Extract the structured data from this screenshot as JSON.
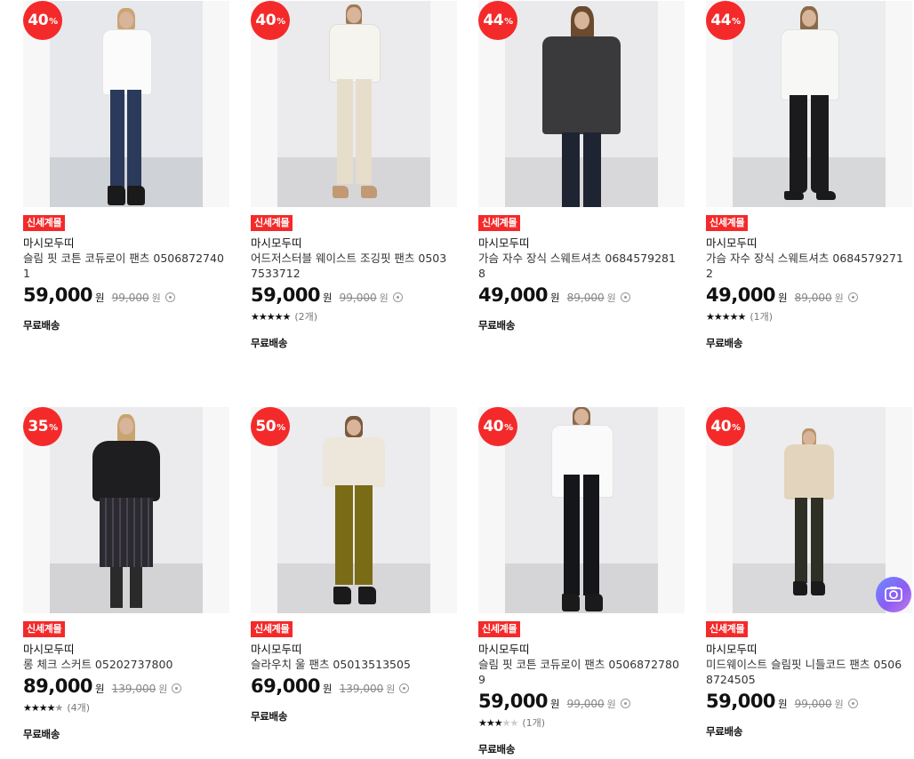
{
  "products": [
    {
      "discount": "40",
      "badge": "신세계몰",
      "brand": "마시모두띠",
      "name": "슬림 핏 코튼 코듀로이 팬츠 05068727401",
      "price": "59,000",
      "original_price": "99,000",
      "currency": "원",
      "stars": null,
      "review_count": null,
      "shipping": "무료배송",
      "look": "white-shirt-navy-jeans"
    },
    {
      "discount": "40",
      "badge": "신세계몰",
      "brand": "마시모두띠",
      "name": "어드저스터블 웨이스트 조깅핏 팬츠 05037533712",
      "price": "59,000",
      "original_price": "99,000",
      "currency": "원",
      "stars": 5,
      "review_count": "(2개)",
      "shipping": "무료배송",
      "look": "cream-sweater-beige-pants"
    },
    {
      "discount": "44",
      "badge": "신세계몰",
      "brand": "마시모두띠",
      "name": "가슴 자수 장식 스웨트셔츠 06845792818",
      "price": "49,000",
      "original_price": "89,000",
      "currency": "원",
      "stars": null,
      "review_count": null,
      "shipping": "무료배송",
      "look": "charcoal-sweatshirt"
    },
    {
      "discount": "44",
      "badge": "신세계몰",
      "brand": "마시모두띠",
      "name": "가슴 자수 장식 스웨트셔츠 06845792712",
      "price": "49,000",
      "original_price": "89,000",
      "currency": "원",
      "stars": 5,
      "review_count": "(1개)",
      "shipping": "무료배송",
      "look": "white-sweatshirt-black-flare"
    },
    {
      "discount": "35",
      "badge": "신세계몰",
      "brand": "마시모두띠",
      "name": "롱 체크 스커트 05202737800",
      "price": "89,000",
      "original_price": "139,000",
      "currency": "원",
      "stars": 4.5,
      "review_count": "(4개)",
      "shipping": "무료배송",
      "look": "black-sweater-check-skirt"
    },
    {
      "discount": "50",
      "badge": "신세계몰",
      "brand": "마시모두띠",
      "name": "슬라우치 울 팬츠 05013513505",
      "price": "69,000",
      "original_price": "139,000",
      "currency": "원",
      "stars": null,
      "review_count": null,
      "shipping": "무료배송",
      "look": "cream-top-olive-pants"
    },
    {
      "discount": "40",
      "badge": "신세계몰",
      "brand": "마시모두띠",
      "name": "슬림 핏 코튼 코듀로이 팬츠 05068727809",
      "price": "59,000",
      "original_price": "99,000",
      "currency": "원",
      "stars": 3,
      "review_count": "(1개)",
      "shipping": "무료배송",
      "look": "white-shirt-black-jeans"
    },
    {
      "discount": "40",
      "badge": "신세계몰",
      "brand": "마시모두띠",
      "name": "미드웨이스트 슬림핏 니들코드 팬츠 05068724505",
      "price": "59,000",
      "original_price": "99,000",
      "currency": "원",
      "stars": null,
      "review_count": null,
      "shipping": "무료배송",
      "look": "beige-knit-dark-pants"
    }
  ],
  "discount_suffix": "%",
  "colors": {
    "accent": "#f42a2a",
    "text": "#111111",
    "muted": "#888888"
  },
  "floating_button": {
    "icon": "camera-search-icon"
  }
}
